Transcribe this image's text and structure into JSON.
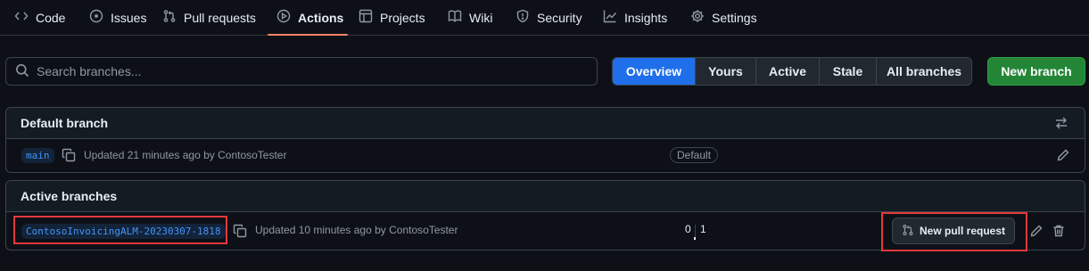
{
  "nav": {
    "items": [
      {
        "label": "Code",
        "icon": "code-icon"
      },
      {
        "label": "Issues",
        "icon": "issue-icon"
      },
      {
        "label": "Pull requests",
        "icon": "pull-request-icon"
      },
      {
        "label": "Actions",
        "icon": "play-icon",
        "selected": true
      },
      {
        "label": "Projects",
        "icon": "table-icon"
      },
      {
        "label": "Wiki",
        "icon": "book-icon"
      },
      {
        "label": "Security",
        "icon": "shield-icon"
      },
      {
        "label": "Insights",
        "icon": "graph-icon"
      },
      {
        "label": "Settings",
        "icon": "gear-icon"
      }
    ]
  },
  "search": {
    "placeholder": "Search branches..."
  },
  "filters": {
    "tabs": [
      "Overview",
      "Yours",
      "Active",
      "Stale",
      "All branches"
    ],
    "active": "Overview"
  },
  "new_branch_label": "New branch",
  "default_section": {
    "title": "Default branch",
    "branch": {
      "name": "main",
      "updated_text": "Updated 21 minutes ago by ContosoTester",
      "badge": "Default"
    }
  },
  "active_section": {
    "title": "Active branches",
    "branch": {
      "name": "ContosoInvoicingALM-20230307-1818",
      "updated_text": "Updated 10 minutes ago by ContosoTester",
      "behind": "0",
      "ahead": "1",
      "pr_label": "New pull request"
    }
  },
  "colors": {
    "accent": "#1f6feb",
    "primary_button": "#238636",
    "selected_underline": "#f78166",
    "highlight_box": "#e5383b",
    "branch_link": "#4493f8"
  }
}
